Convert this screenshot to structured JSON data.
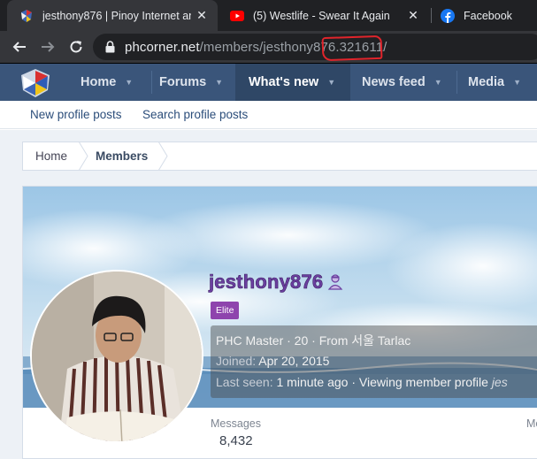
{
  "browser": {
    "tabs": [
      {
        "title": "jesthony876 | Pinoy Internet and",
        "active": true,
        "favicon": "phcorner-logo-icon"
      },
      {
        "title": "(5) Westlife - Swear It Again",
        "active": false,
        "favicon": "youtube-icon"
      },
      {
        "title": "Facebook",
        "active": false,
        "favicon": "facebook-icon"
      }
    ],
    "close_glyph": "✕",
    "url_host": "phcorner.net",
    "url_path": "/members/jesthony876.321611/"
  },
  "site": {
    "nav": [
      {
        "label": "Home"
      },
      {
        "label": "Forums"
      },
      {
        "label": "What's new"
      },
      {
        "label": "News feed"
      },
      {
        "label": "Media"
      }
    ],
    "subnav": [
      "New profile posts",
      "Search profile posts"
    ]
  },
  "breadcrumb": [
    "Home",
    "Members"
  ],
  "profile": {
    "username": "jesthony876",
    "rank_badge": "Elite",
    "info_line1": "PHC Master · 20 · From 서울 Tarlac",
    "joined_label": "Joined:",
    "joined_value": "Apr 20, 2015",
    "last_seen_label": "Last seen:",
    "last_seen_value": "1 minute ago · Viewing member profile",
    "last_seen_trailing": "jes",
    "stats": [
      {
        "label": "Messages",
        "value": "8,432"
      },
      {
        "label": "Me",
        "value": ""
      }
    ]
  },
  "colors": {
    "nav_bg": "#3a557a",
    "username": "#6b3fa0",
    "badge": "#8e44ad",
    "annotation": "#e0242b"
  }
}
